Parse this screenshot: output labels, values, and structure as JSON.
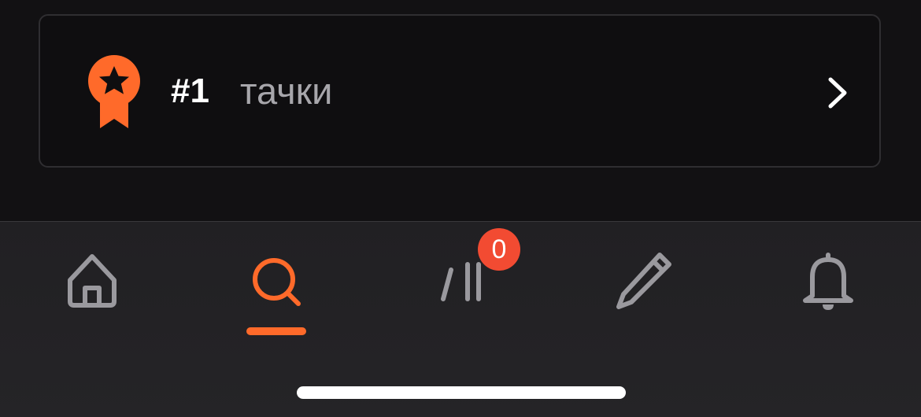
{
  "ranking": {
    "rank": "#1",
    "label": "тачки",
    "icon": "medal-icon",
    "chevron_icon": "chevron-right-icon"
  },
  "tabbar": {
    "tabs": [
      {
        "name": "home",
        "icon": "home-icon",
        "active": false
      },
      {
        "name": "search",
        "icon": "search-icon",
        "active": true
      },
      {
        "name": "posts",
        "icon": "slashes-icon",
        "active": false,
        "badge": "0"
      },
      {
        "name": "write",
        "icon": "pencil-icon",
        "active": false
      },
      {
        "name": "notifications",
        "icon": "bell-icon",
        "active": false
      }
    ]
  },
  "colors": {
    "accent": "#ff6a2a",
    "badge": "#f24b32",
    "icon_inactive": "#9a999e",
    "background": "#121113",
    "tabbar": "#232225"
  }
}
